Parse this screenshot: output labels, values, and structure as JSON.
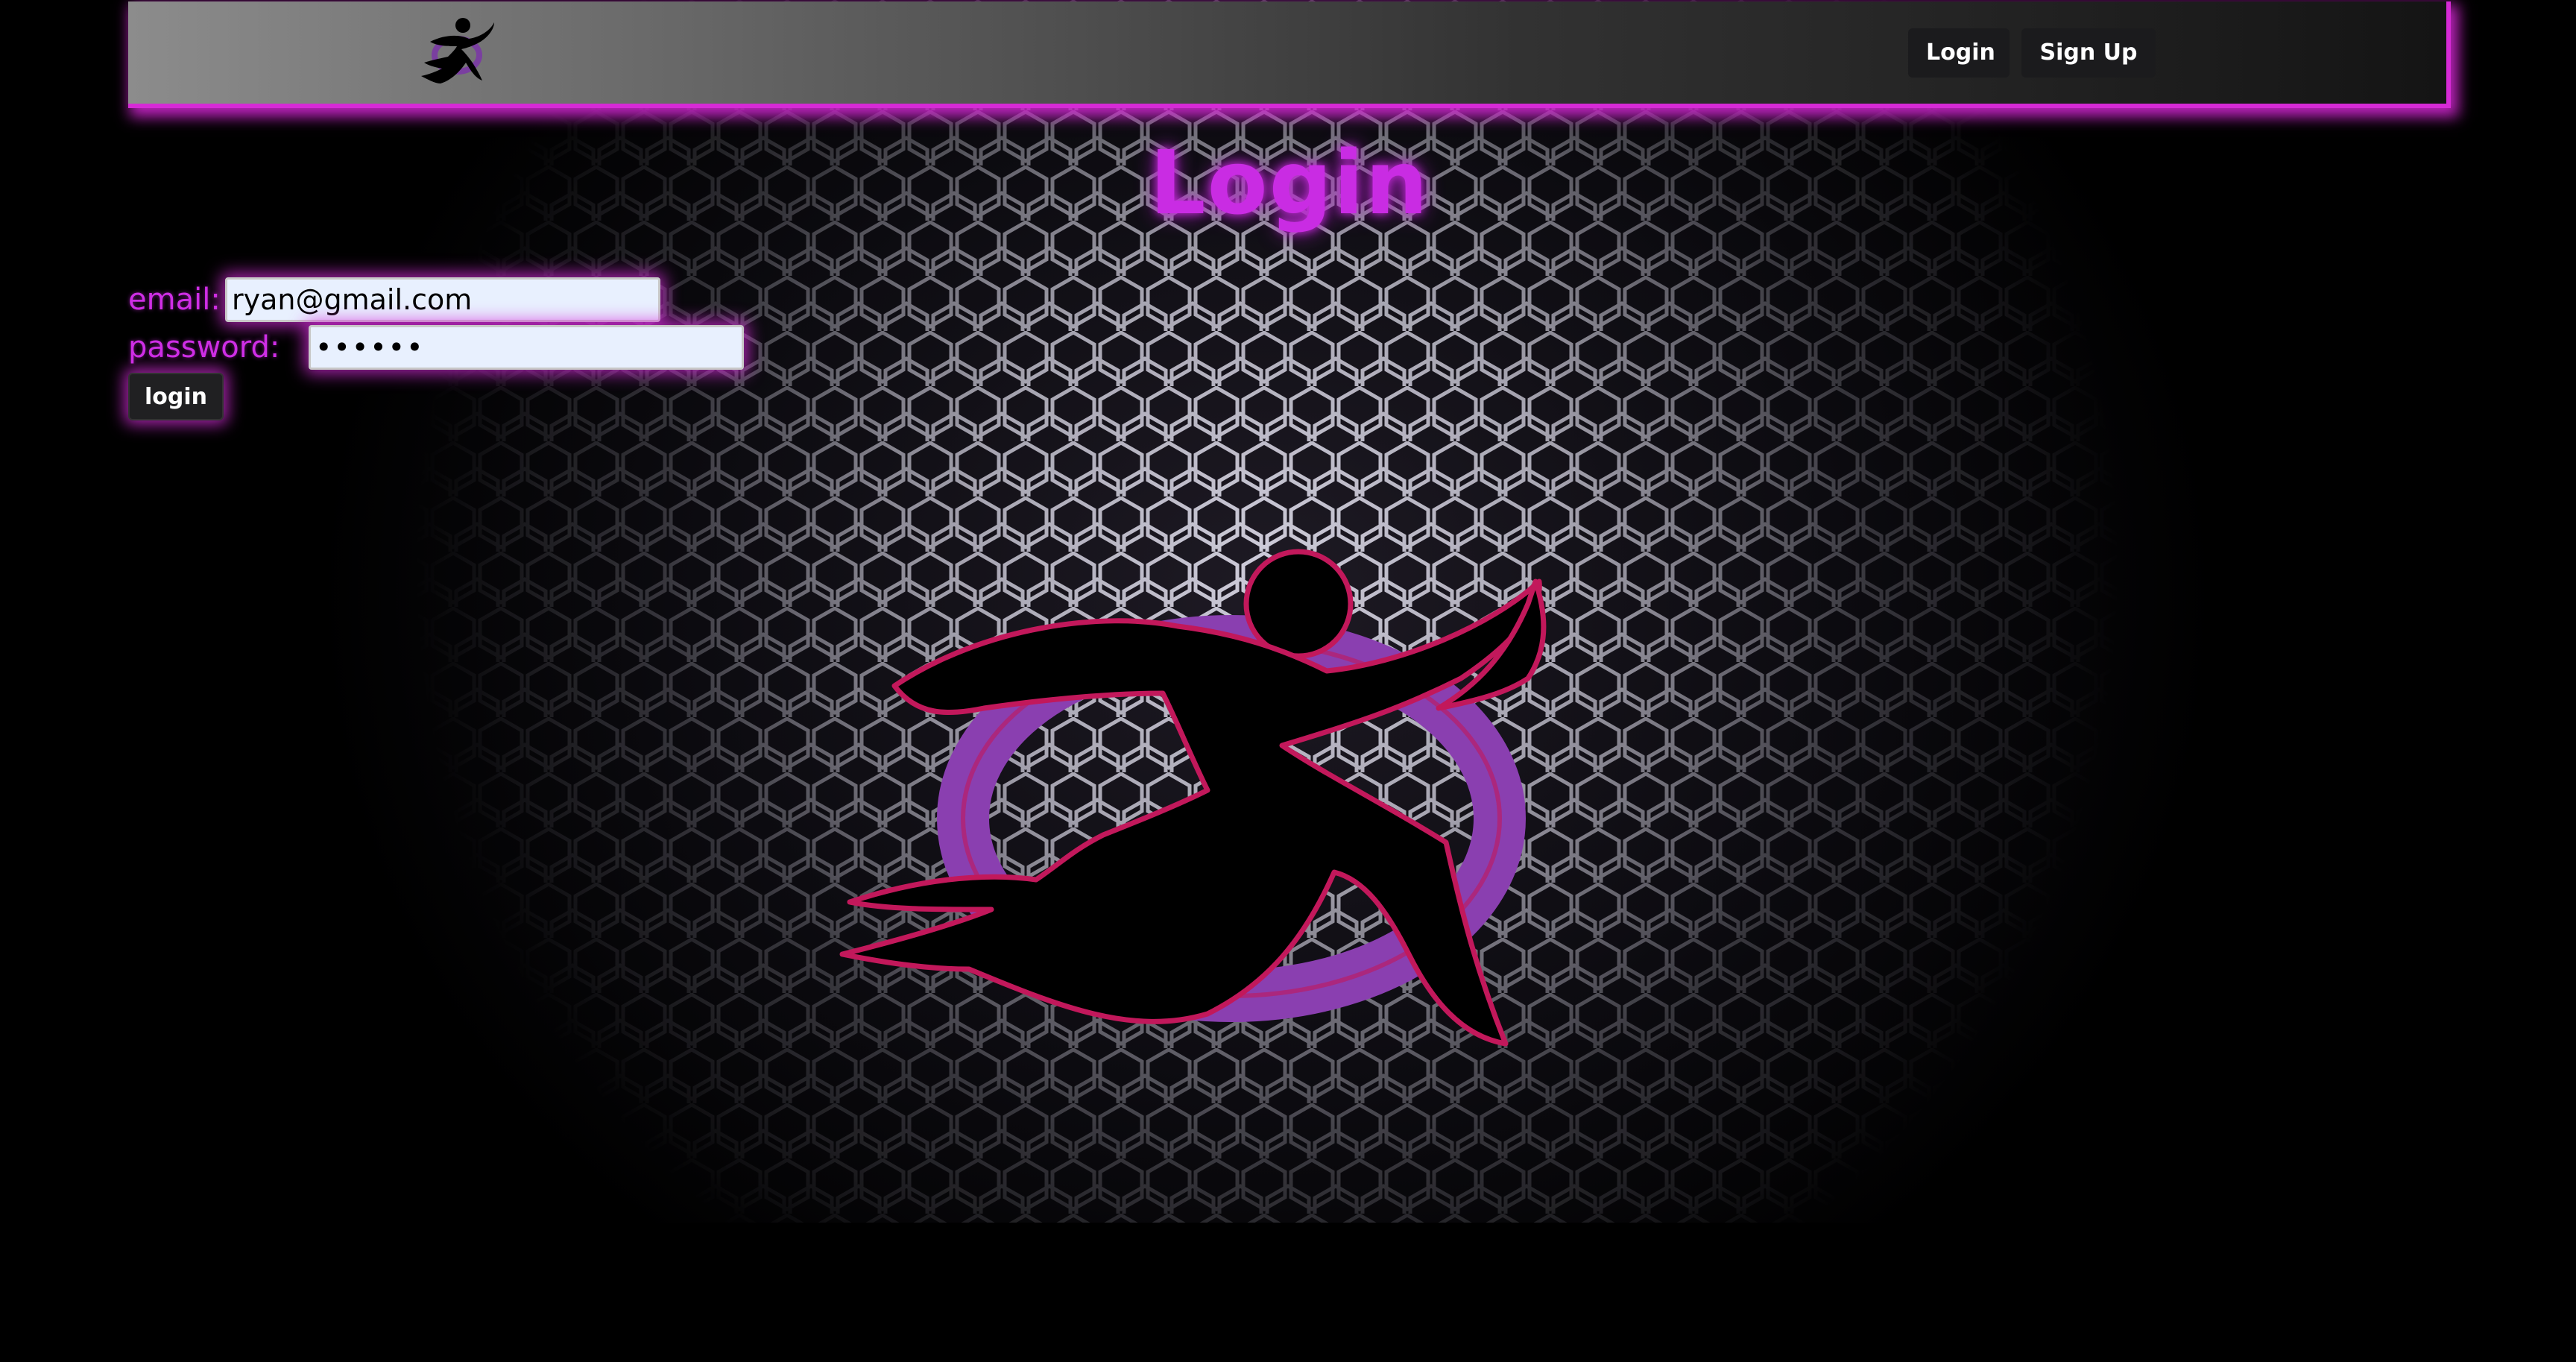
{
  "navbar": {
    "logo_icon": "running-figure-logo-icon",
    "login_label": "Login",
    "signup_label": "Sign Up"
  },
  "main": {
    "title": "Login",
    "form": {
      "email_label": "email:",
      "email_value": "ryan@gmail.com",
      "password_label": "password:",
      "password_value": "••••••",
      "submit_label": "login"
    },
    "emblem_icon": "running-figure-emblem-icon"
  },
  "colors": {
    "accent": "#c92ce3",
    "glow": "#d62ad6",
    "emblem_ring": "#8a3fb0",
    "emblem_outline": "#c2185b",
    "input_bg": "#e8f0fe"
  }
}
